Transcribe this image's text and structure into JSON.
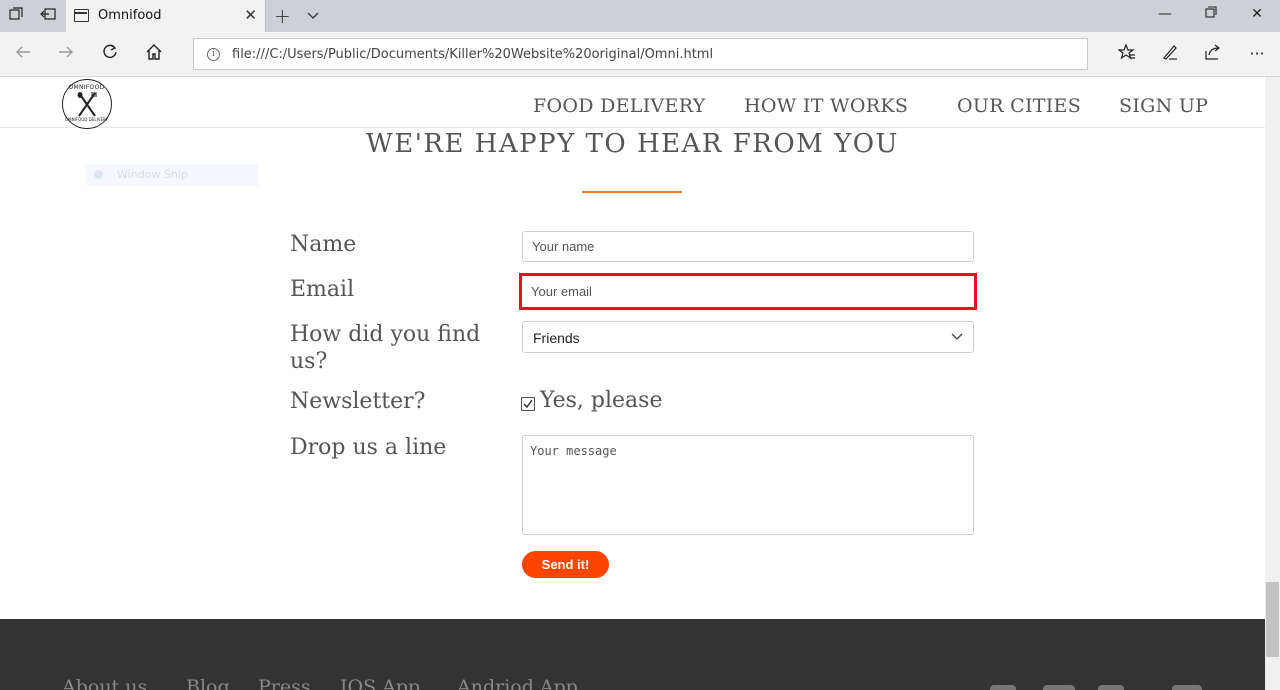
{
  "browser": {
    "tab_title": "Omnifood",
    "url": "file:///C:/Users/Public/Documents/Killer%20Website%20original/Omni.html"
  },
  "header": {
    "logo_top": "OMNIFOOD",
    "logo_bottom": "OMNIFOOD DELIVERY",
    "nav": [
      "FOOD DELIVERY",
      "HOW IT WORKS",
      "OUR CITIES",
      "SIGN UP"
    ]
  },
  "overlay": {
    "snip_label": "Window Snip"
  },
  "form": {
    "title": "WE'RE HAPPY TO HEAR FROM YOU",
    "name_label": "Name",
    "name_placeholder": "Your name",
    "email_label": "Email",
    "email_placeholder": "Your email",
    "find_label_line1": "How did you find",
    "find_label_line2": "us?",
    "find_selected": "Friends",
    "newsletter_label": "Newsletter?",
    "newsletter_option": "Yes, please",
    "newsletter_checked": true,
    "message_label": "Drop us a line",
    "message_placeholder": "Your message",
    "send_label": "Send it!"
  },
  "footer": {
    "links": [
      "About us",
      "Blog",
      "Press",
      "IOS App",
      "Andriod App"
    ]
  },
  "colors": {
    "accent": "#e67e22",
    "button": "#ff4500",
    "focus_outline": "#e81123",
    "footer_bg": "#333333"
  },
  "icons": {
    "social": [
      "facebook-icon",
      "twitter-icon",
      "google-plus-icon",
      "instagram-icon"
    ]
  }
}
